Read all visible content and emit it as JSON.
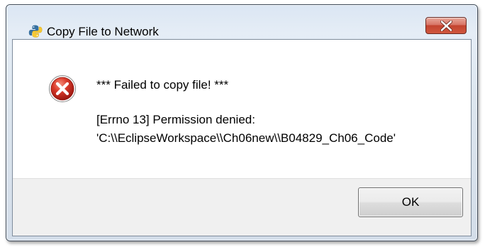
{
  "window": {
    "title": "Copy File to Network",
    "app_icon": "python-logo-icon",
    "close_icon": "close-x-icon"
  },
  "message": {
    "icon": "error-icon",
    "line1": "*** Failed to copy file! ***",
    "line2": "[Errno 13] Permission denied:",
    "line3": "'C:\\\\EclipseWorkspace\\\\Ch06new\\\\B04829_Ch06_Code'"
  },
  "buttons": {
    "ok_label": "OK"
  },
  "colors": {
    "close_button": "#c7473a",
    "error_icon": "#c8281e",
    "footer_background": "#f0f0f0"
  }
}
